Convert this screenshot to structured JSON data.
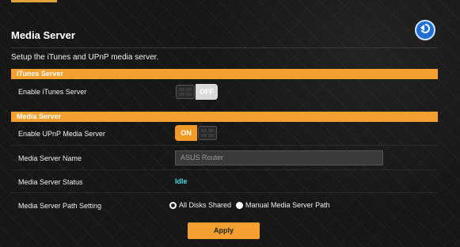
{
  "page": {
    "title": "Media Server",
    "subtitle": "Setup the iTunes and UPnP media server."
  },
  "itunes": {
    "section_title": "iTunes Server",
    "enable_label": "Enable iTunes Server",
    "toggle_text": "OFF",
    "toggle_state": "off"
  },
  "media": {
    "section_title": "Media Server",
    "upnp_label": "Enable UPnP Media Server",
    "upnp_toggle_text": "ON",
    "upnp_toggle_state": "on",
    "name_label": "Media Server Name",
    "name_value": "ASUS Router",
    "status_label": "Media Server Status",
    "status_value": "Idle",
    "path_label": "Media Server Path Setting",
    "path_options": [
      "All Disks Shared",
      "Manual Media Server Path"
    ],
    "path_selected": "All Disks Shared"
  },
  "actions": {
    "apply_label": "Apply"
  },
  "colors": {
    "accent": "#f3a030",
    "status": "#4fd7e8",
    "back_button": "#1f6fd6"
  },
  "icons": {
    "back": "back-arrow-icon"
  }
}
